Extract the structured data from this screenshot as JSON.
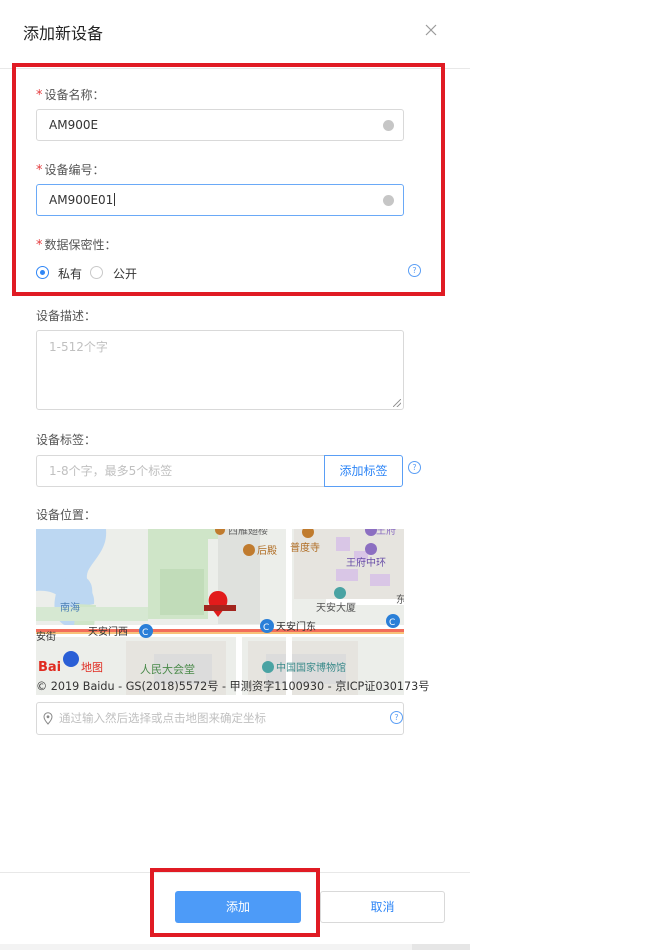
{
  "dialog": {
    "title": "添加新设备"
  },
  "form": {
    "device_name": {
      "label": "设备名称：",
      "value": "AM900E"
    },
    "device_number": {
      "label": "设备编号：",
      "value": "AM900E01"
    },
    "privacy": {
      "label": "数据保密性：",
      "options": [
        "私有",
        "公开"
      ],
      "selected": "私有"
    },
    "description": {
      "label": "设备描述：",
      "placeholder": "1-512个字"
    },
    "tags": {
      "label": "设备标签：",
      "placeholder": "1-8个字，最多5个标签",
      "add_button": "添加标签"
    },
    "location": {
      "label": "设备位置：",
      "placeholder": "通过输入然后选择或点击地图来确定坐标"
    }
  },
  "map": {
    "labels": [
      "西雁翅楼",
      "王府",
      "后殿",
      "普度寺",
      "王府中环",
      "南海",
      "天安大厦",
      "天安门西",
      "天安门东",
      "安街",
      "人民大会堂",
      "中国国家博物馆",
      "东"
    ],
    "logo": "Bai",
    "logo_suffix": "地图",
    "credit": "© 2019 Baidu - GS(2018)5572号 - 甲测资字1100930 - 京ICP证030173号"
  },
  "footer": {
    "submit": "添加",
    "cancel": "取消"
  },
  "colors": {
    "primary": "#4d9bf8",
    "required": "#e4393c",
    "highlight_box": "#e01b24"
  }
}
